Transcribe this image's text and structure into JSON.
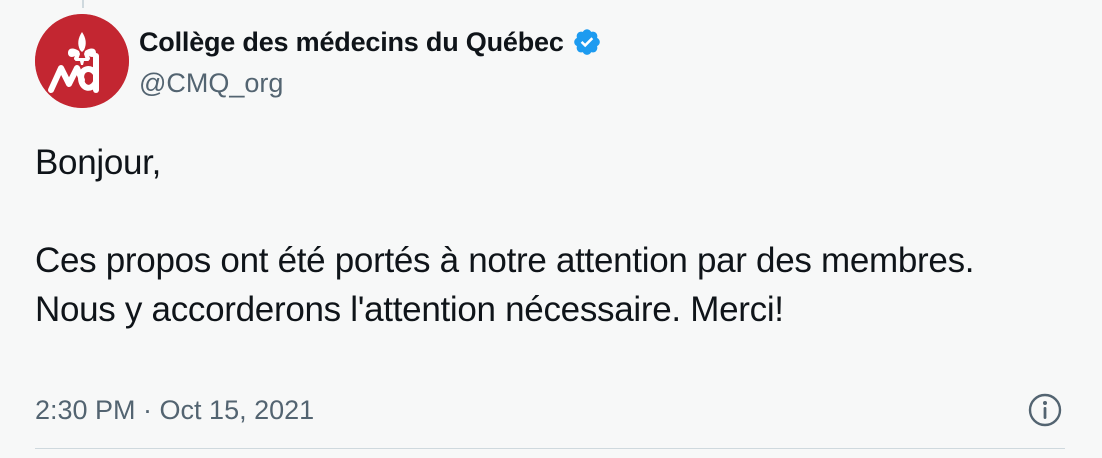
{
  "tweet": {
    "author": {
      "display_name": "Collège des médecins du Québec",
      "handle": "@CMQ_org",
      "verified": true,
      "avatar_icon": "cmq-logo-icon",
      "avatar_color": "#c32631"
    },
    "text": {
      "line1": "Bonjour,",
      "paragraph2": "Ces propos ont été portés à notre attention par des membres. Nous y accorderons l'attention nécessaire. Merci!"
    },
    "timestamp": "2:30 PM · Oct 15, 2021",
    "info_icon": "info-icon"
  },
  "colors": {
    "background": "#f7f8f8",
    "text_primary": "#0f1419",
    "text_secondary": "#536471",
    "verified_blue": "#1d9bf0",
    "divider": "#cfd9de"
  }
}
